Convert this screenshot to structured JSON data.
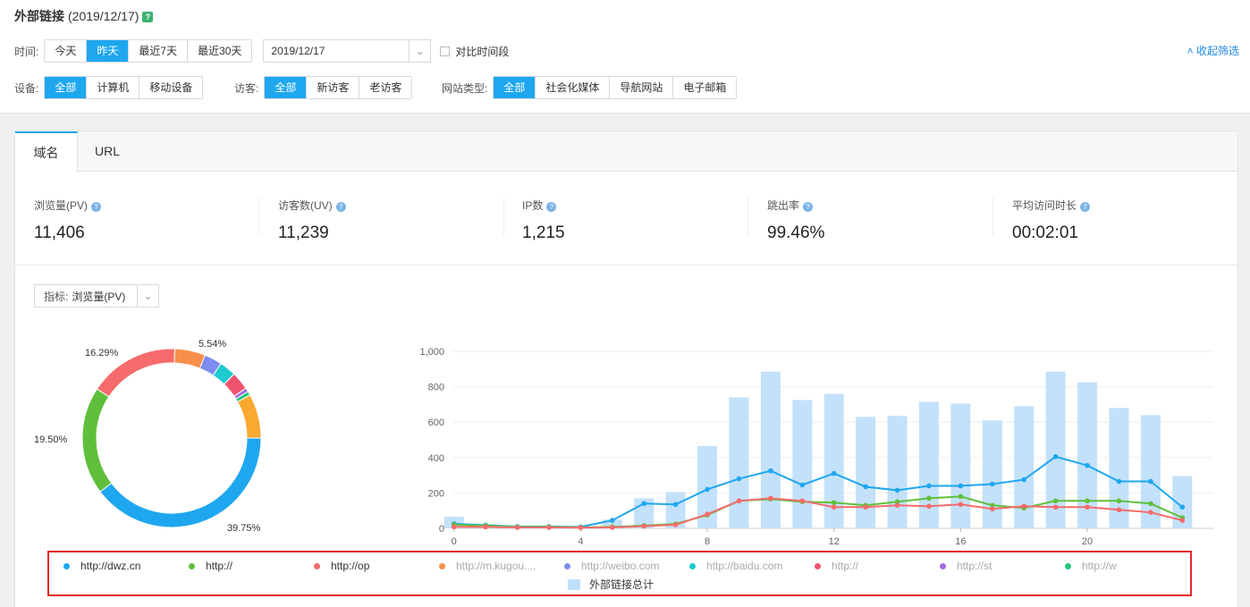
{
  "page": {
    "title": "外部链接",
    "date": "(2019/12/17)",
    "help": "?"
  },
  "time_filter": {
    "label": "时间:",
    "buttons": [
      "今天",
      "昨天",
      "最近7天",
      "最近30天"
    ],
    "active": 1,
    "date_value": "2019/12/17",
    "compare_label": "对比时间段"
  },
  "collapse_label": "收起筛选",
  "device_filter": {
    "label": "设备:",
    "buttons": [
      "全部",
      "计算机",
      "移动设备"
    ],
    "active": 0
  },
  "visitor_filter": {
    "label": "访客:",
    "buttons": [
      "全部",
      "新访客",
      "老访客"
    ],
    "active": 0
  },
  "site_filter": {
    "label": "网站类型:",
    "buttons": [
      "全部",
      "社会化媒体",
      "导航网站",
      "电子邮箱"
    ],
    "active": 0
  },
  "tabs": [
    "域名",
    "URL"
  ],
  "stats": [
    {
      "label": "浏览量(PV)",
      "value": "11,406"
    },
    {
      "label": "访客数(UV)",
      "value": "11,239"
    },
    {
      "label": "IP数",
      "value": "1,215"
    },
    {
      "label": "跳出率",
      "value": "99.46%"
    },
    {
      "label": "平均访问时长",
      "value": "00:02:01"
    }
  ],
  "metric_select": {
    "label": "指标:",
    "value": "浏览量(PV)"
  },
  "colors": {
    "accent": "#1ea7ef",
    "highlight_border": "#e8262b",
    "bar": "#bfe0fa"
  },
  "chart_data": [
    {
      "type": "pie",
      "donut": true,
      "slices": [
        {
          "value": 39.75,
          "color": "#1ea7ef",
          "label": "39.75%"
        },
        {
          "value": 19.5,
          "color": "#5fbf3c",
          "label": "19.50%"
        },
        {
          "value": 16.29,
          "color": "#f66b6b",
          "label": "16.29%"
        },
        {
          "value": 5.54,
          "color": "#f88f4b",
          "label": "5.54%"
        },
        {
          "value": 3.2,
          "color": "#7d8cf0",
          "label": ""
        },
        {
          "value": 3.0,
          "color": "#1fc9d0",
          "label": ""
        },
        {
          "value": 3.3,
          "color": "#f0536d",
          "label": ""
        },
        {
          "value": 0.7,
          "color": "#a36ee0",
          "label": ""
        },
        {
          "value": 0.7,
          "color": "#22c77a",
          "label": ""
        },
        {
          "value": 8.0,
          "color": "#f9a830",
          "label": ""
        }
      ]
    },
    {
      "type": "bar+line",
      "x": [
        0,
        1,
        2,
        3,
        4,
        5,
        6,
        7,
        8,
        9,
        10,
        11,
        12,
        13,
        14,
        15,
        16,
        17,
        18,
        19,
        20,
        21,
        22,
        23
      ],
      "xticks": [
        "0",
        "4",
        "8",
        "12",
        "16",
        "20"
      ],
      "yticks": [
        "0",
        "200",
        "400",
        "600",
        "800",
        "1,000"
      ],
      "ylim": [
        0,
        1000
      ],
      "bars": {
        "name": "外部链接总计",
        "values": [
          65,
          20,
          12,
          15,
          10,
          50,
          170,
          205,
          465,
          740,
          885,
          725,
          760,
          630,
          635,
          715,
          705,
          610,
          690,
          885,
          825,
          680,
          640,
          295
        ]
      },
      "series": [
        {
          "name": "http://dwz.cn",
          "color": "#1ea7ef",
          "values": [
            25,
            18,
            10,
            10,
            8,
            45,
            140,
            135,
            220,
            280,
            325,
            245,
            310,
            235,
            215,
            240,
            240,
            250,
            275,
            405,
            355,
            265,
            265,
            120
          ]
        },
        {
          "name": "http://",
          "color": "#5fbf3c",
          "values": [
            20,
            15,
            8,
            8,
            5,
            8,
            15,
            25,
            75,
            155,
            165,
            150,
            145,
            130,
            150,
            170,
            180,
            130,
            115,
            155,
            155,
            155,
            140,
            60
          ]
        },
        {
          "name": "http://op",
          "color": "#f66b6b",
          "values": [
            8,
            8,
            5,
            5,
            4,
            5,
            12,
            20,
            80,
            155,
            170,
            155,
            120,
            120,
            130,
            125,
            135,
            110,
            125,
            120,
            120,
            105,
            90,
            45
          ]
        }
      ]
    }
  ],
  "legend": {
    "items": [
      {
        "label": "http://dwz.cn",
        "color": "#1ea7ef",
        "active": true
      },
      {
        "label": "http://",
        "color": "#5fbf3c",
        "active": true
      },
      {
        "label": "http://op",
        "color": "#f66b6b",
        "active": true
      },
      {
        "label": "http://m.kugou....",
        "color": "#f88f4b",
        "active": false
      },
      {
        "label": "http://weibo.com",
        "color": "#7d8cf0",
        "active": false
      },
      {
        "label": "http://baidu.com",
        "color": "#1fc9d0",
        "active": false
      },
      {
        "label": "http://",
        "color": "#f0536d",
        "active": false
      },
      {
        "label": "http://st",
        "color": "#a36ee0",
        "active": false
      },
      {
        "label": "http://w",
        "color": "#22c77a",
        "active": false
      }
    ],
    "total_label": "外部链接总计"
  }
}
